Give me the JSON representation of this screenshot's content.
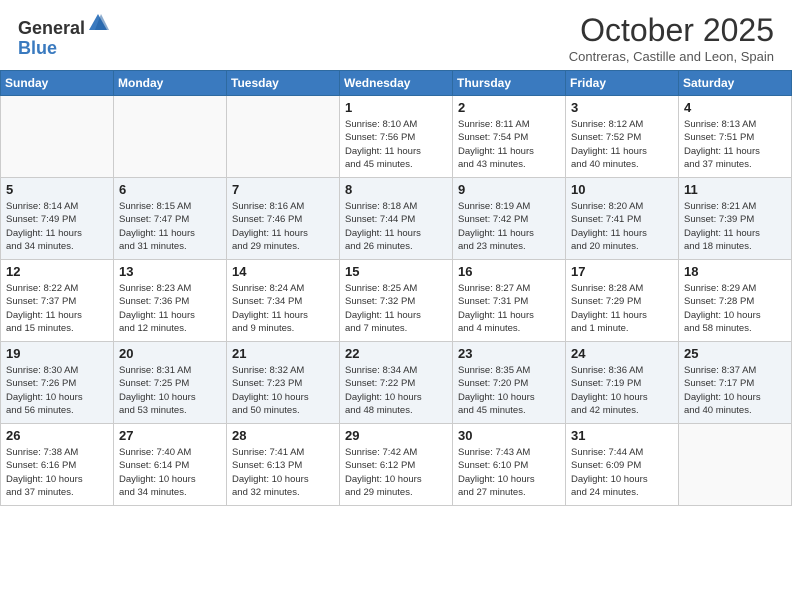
{
  "header": {
    "logo_general": "General",
    "logo_blue": "Blue",
    "month_title": "October 2025",
    "location": "Contreras, Castille and Leon, Spain"
  },
  "days_of_week": [
    "Sunday",
    "Monday",
    "Tuesday",
    "Wednesday",
    "Thursday",
    "Friday",
    "Saturday"
  ],
  "weeks": [
    [
      {
        "day": "",
        "info": ""
      },
      {
        "day": "",
        "info": ""
      },
      {
        "day": "",
        "info": ""
      },
      {
        "day": "1",
        "info": "Sunrise: 8:10 AM\nSunset: 7:56 PM\nDaylight: 11 hours\nand 45 minutes."
      },
      {
        "day": "2",
        "info": "Sunrise: 8:11 AM\nSunset: 7:54 PM\nDaylight: 11 hours\nand 43 minutes."
      },
      {
        "day": "3",
        "info": "Sunrise: 8:12 AM\nSunset: 7:52 PM\nDaylight: 11 hours\nand 40 minutes."
      },
      {
        "day": "4",
        "info": "Sunrise: 8:13 AM\nSunset: 7:51 PM\nDaylight: 11 hours\nand 37 minutes."
      }
    ],
    [
      {
        "day": "5",
        "info": "Sunrise: 8:14 AM\nSunset: 7:49 PM\nDaylight: 11 hours\nand 34 minutes."
      },
      {
        "day": "6",
        "info": "Sunrise: 8:15 AM\nSunset: 7:47 PM\nDaylight: 11 hours\nand 31 minutes."
      },
      {
        "day": "7",
        "info": "Sunrise: 8:16 AM\nSunset: 7:46 PM\nDaylight: 11 hours\nand 29 minutes."
      },
      {
        "day": "8",
        "info": "Sunrise: 8:18 AM\nSunset: 7:44 PM\nDaylight: 11 hours\nand 26 minutes."
      },
      {
        "day": "9",
        "info": "Sunrise: 8:19 AM\nSunset: 7:42 PM\nDaylight: 11 hours\nand 23 minutes."
      },
      {
        "day": "10",
        "info": "Sunrise: 8:20 AM\nSunset: 7:41 PM\nDaylight: 11 hours\nand 20 minutes."
      },
      {
        "day": "11",
        "info": "Sunrise: 8:21 AM\nSunset: 7:39 PM\nDaylight: 11 hours\nand 18 minutes."
      }
    ],
    [
      {
        "day": "12",
        "info": "Sunrise: 8:22 AM\nSunset: 7:37 PM\nDaylight: 11 hours\nand 15 minutes."
      },
      {
        "day": "13",
        "info": "Sunrise: 8:23 AM\nSunset: 7:36 PM\nDaylight: 11 hours\nand 12 minutes."
      },
      {
        "day": "14",
        "info": "Sunrise: 8:24 AM\nSunset: 7:34 PM\nDaylight: 11 hours\nand 9 minutes."
      },
      {
        "day": "15",
        "info": "Sunrise: 8:25 AM\nSunset: 7:32 PM\nDaylight: 11 hours\nand 7 minutes."
      },
      {
        "day": "16",
        "info": "Sunrise: 8:27 AM\nSunset: 7:31 PM\nDaylight: 11 hours\nand 4 minutes."
      },
      {
        "day": "17",
        "info": "Sunrise: 8:28 AM\nSunset: 7:29 PM\nDaylight: 11 hours\nand 1 minute."
      },
      {
        "day": "18",
        "info": "Sunrise: 8:29 AM\nSunset: 7:28 PM\nDaylight: 10 hours\nand 58 minutes."
      }
    ],
    [
      {
        "day": "19",
        "info": "Sunrise: 8:30 AM\nSunset: 7:26 PM\nDaylight: 10 hours\nand 56 minutes."
      },
      {
        "day": "20",
        "info": "Sunrise: 8:31 AM\nSunset: 7:25 PM\nDaylight: 10 hours\nand 53 minutes."
      },
      {
        "day": "21",
        "info": "Sunrise: 8:32 AM\nSunset: 7:23 PM\nDaylight: 10 hours\nand 50 minutes."
      },
      {
        "day": "22",
        "info": "Sunrise: 8:34 AM\nSunset: 7:22 PM\nDaylight: 10 hours\nand 48 minutes."
      },
      {
        "day": "23",
        "info": "Sunrise: 8:35 AM\nSunset: 7:20 PM\nDaylight: 10 hours\nand 45 minutes."
      },
      {
        "day": "24",
        "info": "Sunrise: 8:36 AM\nSunset: 7:19 PM\nDaylight: 10 hours\nand 42 minutes."
      },
      {
        "day": "25",
        "info": "Sunrise: 8:37 AM\nSunset: 7:17 PM\nDaylight: 10 hours\nand 40 minutes."
      }
    ],
    [
      {
        "day": "26",
        "info": "Sunrise: 7:38 AM\nSunset: 6:16 PM\nDaylight: 10 hours\nand 37 minutes."
      },
      {
        "day": "27",
        "info": "Sunrise: 7:40 AM\nSunset: 6:14 PM\nDaylight: 10 hours\nand 34 minutes."
      },
      {
        "day": "28",
        "info": "Sunrise: 7:41 AM\nSunset: 6:13 PM\nDaylight: 10 hours\nand 32 minutes."
      },
      {
        "day": "29",
        "info": "Sunrise: 7:42 AM\nSunset: 6:12 PM\nDaylight: 10 hours\nand 29 minutes."
      },
      {
        "day": "30",
        "info": "Sunrise: 7:43 AM\nSunset: 6:10 PM\nDaylight: 10 hours\nand 27 minutes."
      },
      {
        "day": "31",
        "info": "Sunrise: 7:44 AM\nSunset: 6:09 PM\nDaylight: 10 hours\nand 24 minutes."
      },
      {
        "day": "",
        "info": ""
      }
    ]
  ]
}
